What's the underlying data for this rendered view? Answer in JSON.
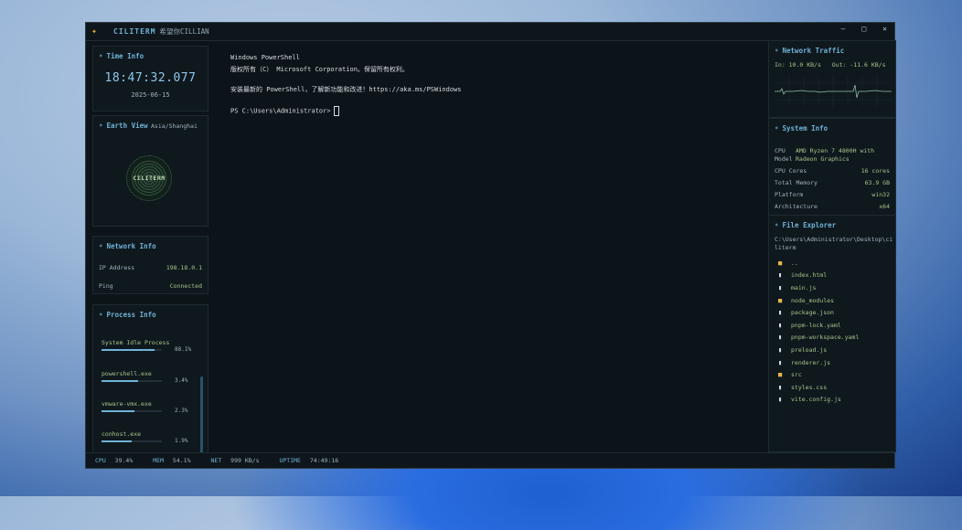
{
  "app": {
    "title": "CILITERM",
    "subtitle": "希望你CILLIAN"
  },
  "window_controls": {
    "minimize": "—",
    "maximize": "□",
    "close": "✕"
  },
  "time_info": {
    "title": "Time Info",
    "clock": "18:47:32.077",
    "date": "2025-06-15"
  },
  "earth_view": {
    "title": "Earth View",
    "timezone": "Asia/Shanghai",
    "globe_label": "CILITERM"
  },
  "network_info": {
    "title": "Network Info",
    "ip_label": "IP Address",
    "ip_value": "198.18.0.1",
    "ping_label": "Ping",
    "ping_value": "Connected"
  },
  "process_info": {
    "title": "Process Info",
    "processes": [
      {
        "name": "System Idle Process",
        "pct_label": "88.1%",
        "pct": 88.1
      },
      {
        "name": "powershell.exe",
        "pct_label": "3.4%",
        "pct": 3.4
      },
      {
        "name": "vmware-vmx.exe",
        "pct_label": "2.3%",
        "pct": 2.3
      },
      {
        "name": "conhost.exe",
        "pct_label": "1.9%",
        "pct": 1.9
      }
    ]
  },
  "terminal": {
    "lines": [
      "Windows PowerShell",
      "版权所有（C） Microsoft Corporation。保留所有权利。",
      "",
      "安装最新的 PowerShell，了解新功能和改进！https://aka.ms/PSWindows",
      "",
      "PS C:\\Users\\Administrator>"
    ]
  },
  "network_traffic": {
    "title": "Network Traffic",
    "in": "In: 10.0 KB/s",
    "out": "Out: -11.6 KB/s"
  },
  "system_info": {
    "title": "System Info",
    "cpu_label": "CPU\nModel",
    "cpu_value": "AMD Ryzen 7 4800H with Radeon Graphics",
    "rows": [
      {
        "label": "CPU Cores",
        "value": "16 cores"
      },
      {
        "label": "Total Memory",
        "value": "63.9 GB"
      },
      {
        "label": "Platform",
        "value": "win32"
      },
      {
        "label": "Architecture",
        "value": "x64"
      }
    ]
  },
  "file_explorer": {
    "title": "File Explorer",
    "path": "C:\\Users\\Administrator\\Desktop\\ciliterm",
    "items": [
      {
        "name": "..",
        "type": "folder"
      },
      {
        "name": "index.html",
        "type": "file"
      },
      {
        "name": "main.js",
        "type": "file"
      },
      {
        "name": "node_modules",
        "type": "folder"
      },
      {
        "name": "package.json",
        "type": "file"
      },
      {
        "name": "pnpm-lock.yaml",
        "type": "file"
      },
      {
        "name": "pnpm-workspace.yaml",
        "type": "file"
      },
      {
        "name": "preload.js",
        "type": "file"
      },
      {
        "name": "renderer.js",
        "type": "file"
      },
      {
        "name": "src",
        "type": "folder"
      },
      {
        "name": "styles.css",
        "type": "file"
      },
      {
        "name": "vite.config.js",
        "type": "file"
      }
    ]
  },
  "statusbar": {
    "cpu_label": "CPU",
    "cpu": "39.4%",
    "mem_label": "MEM",
    "mem": "54.1%",
    "net_label": "NET",
    "net": "999 KB/s",
    "uptime_label": "UPTIME",
    "uptime": "74:49:16"
  }
}
